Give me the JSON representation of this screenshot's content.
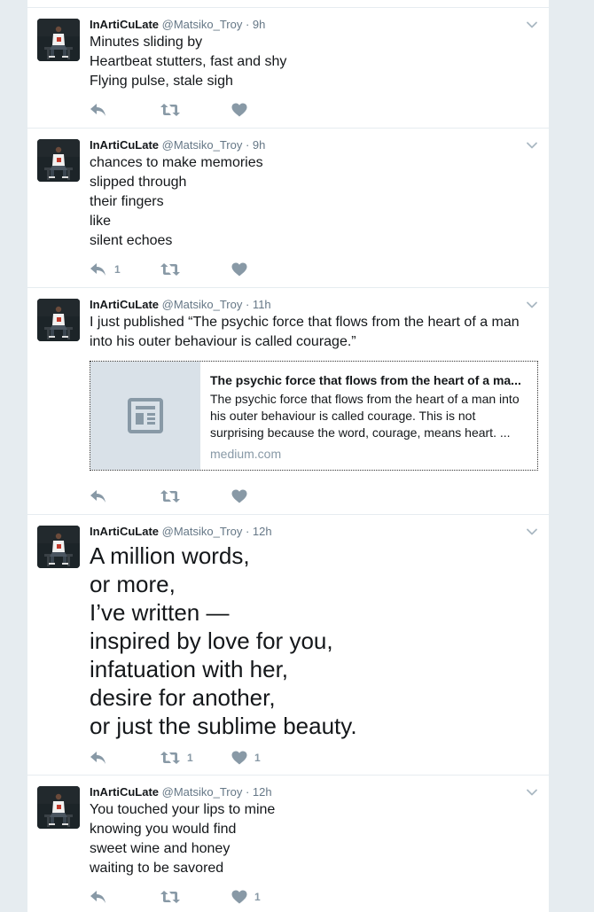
{
  "tweets": [
    {
      "name": "InArtiCuLate",
      "handle": "@Matsiko_Troy",
      "time": "· 9h",
      "lines": [
        "Minutes sliding by",
        "Heartbeat stutters, fast and shy",
        "Flying pulse, stale sigh"
      ],
      "reply_count": "",
      "retweet_count": "",
      "like_count": ""
    },
    {
      "name": "InArtiCuLate",
      "handle": "@Matsiko_Troy",
      "time": "· 9h",
      "lines": [
        "chances to make memories",
        "slipped through",
        "their fingers",
        "like",
        "silent echoes"
      ],
      "reply_count": "1",
      "retweet_count": "",
      "like_count": ""
    },
    {
      "name": "InArtiCuLate",
      "handle": "@Matsiko_Troy",
      "time": "· 11h",
      "lines": [
        "I just published “The psychic force that flows from the heart of a man",
        "into his outer behaviour is called courage.”"
      ],
      "card": {
        "title": "The psychic force that flows from the heart of a ma...",
        "description": "The psychic force that flows from the heart of a man into his outer behaviour is called courage. This is not surprising because the word, courage, means heart. ...",
        "domain": "medium.com"
      },
      "reply_count": "",
      "retweet_count": "",
      "like_count": ""
    },
    {
      "name": "InArtiCuLate",
      "handle": "@Matsiko_Troy",
      "time": "· 12h",
      "lines": [
        "A million words,",
        "or more,",
        "I’ve written —",
        "inspired by love for you,",
        "infatuation with her,",
        "desire for another,",
        "or just the sublime beauty."
      ],
      "reply_count": "",
      "retweet_count": "1",
      "like_count": "1"
    },
    {
      "name": "InArtiCuLate",
      "handle": "@Matsiko_Troy",
      "time": "· 12h",
      "lines": [
        "You touched your lips to mine",
        "knowing you would find",
        "sweet wine and honey",
        "waiting to be savored"
      ],
      "reply_count": "",
      "retweet_count": "",
      "like_count": "1"
    }
  ],
  "icons": {
    "reply": "reply-icon",
    "retweet": "retweet-icon",
    "like": "heart-icon",
    "caret": "chevron-down-icon",
    "card_placeholder": "article-icon"
  },
  "colors": {
    "action_icon": "#8899a6",
    "secondary_text": "#657786",
    "card_thumb": "#d9e1e8"
  }
}
